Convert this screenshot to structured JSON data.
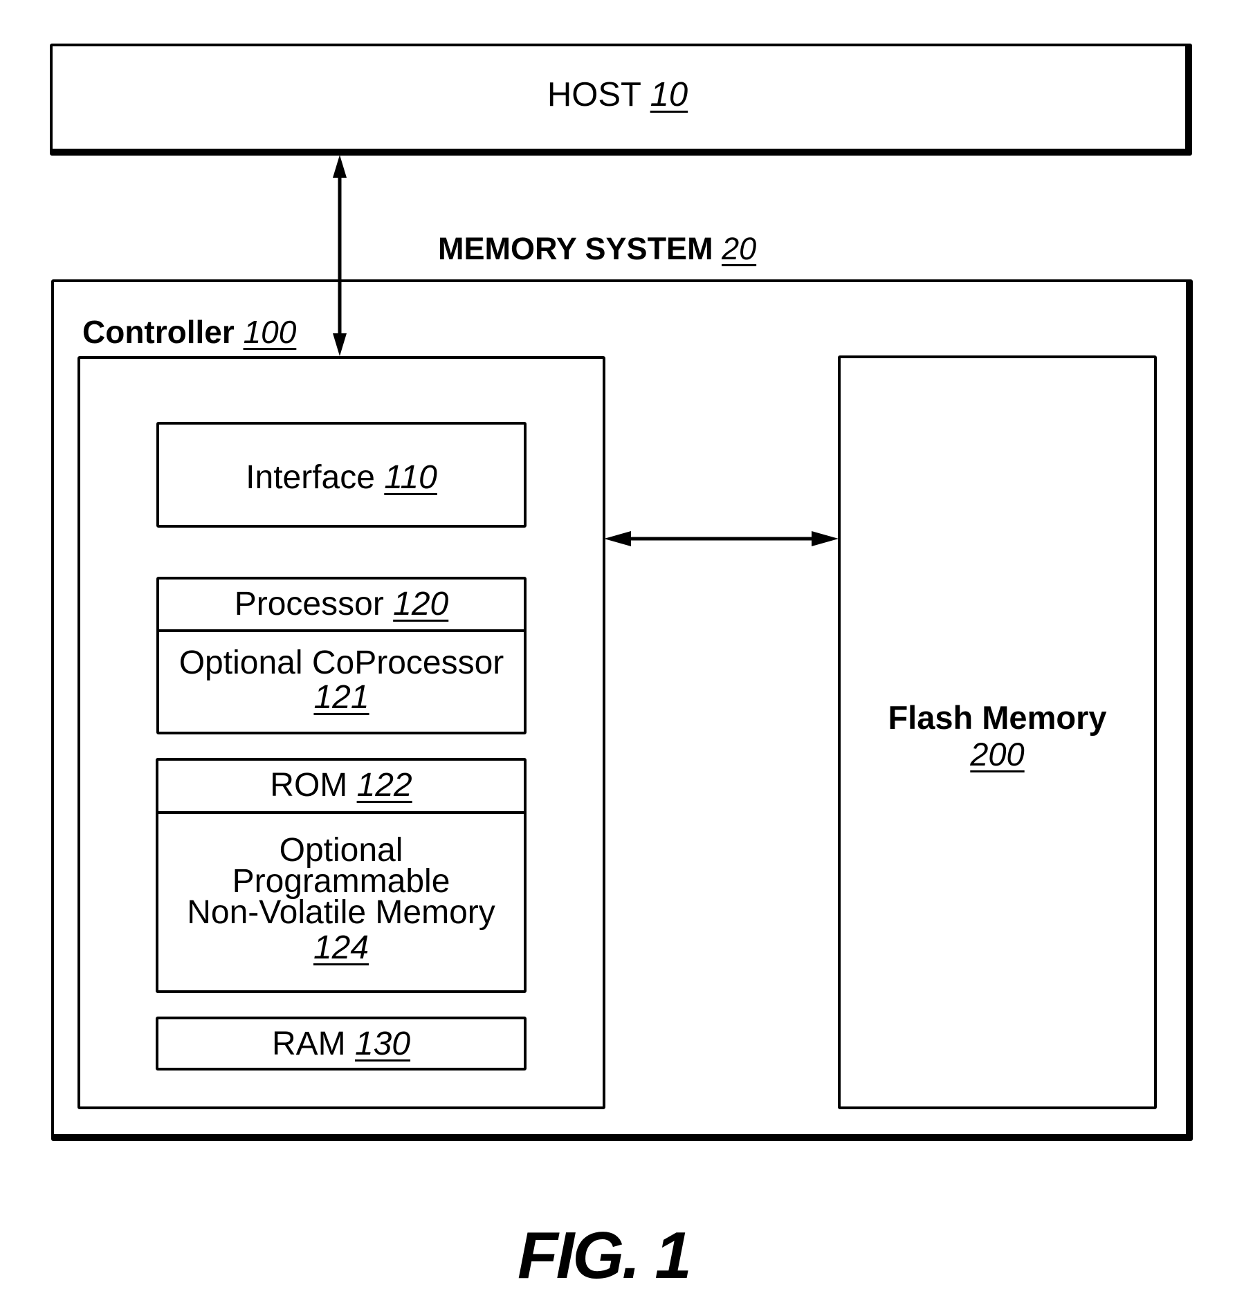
{
  "figure": {
    "caption": "FIG. 1",
    "host": {
      "name": "HOST",
      "ref": "10"
    },
    "memory_system": {
      "name": "MEMORY SYSTEM",
      "ref": "20"
    },
    "controller": {
      "name": "Controller",
      "ref": "100"
    },
    "interface": {
      "name": "Interface",
      "ref": "110"
    },
    "processor": {
      "name": "Processor",
      "ref": "120"
    },
    "coprocessor": {
      "name": "Optional CoProcessor",
      "ref": "121"
    },
    "rom": {
      "name": "ROM",
      "ref": "122"
    },
    "nvm": {
      "lines": [
        "Optional",
        "Programmable",
        "Non-Volatile Memory"
      ],
      "ref": "124"
    },
    "ram": {
      "name": "RAM",
      "ref": "130"
    },
    "flash": {
      "name": "Flash Memory",
      "ref": "200"
    },
    "connections": [
      {
        "from": "HOST 10",
        "to": "Controller 100",
        "type": "bidirectional"
      },
      {
        "from": "Controller 100",
        "to": "Flash Memory 200",
        "type": "bidirectional"
      }
    ]
  }
}
